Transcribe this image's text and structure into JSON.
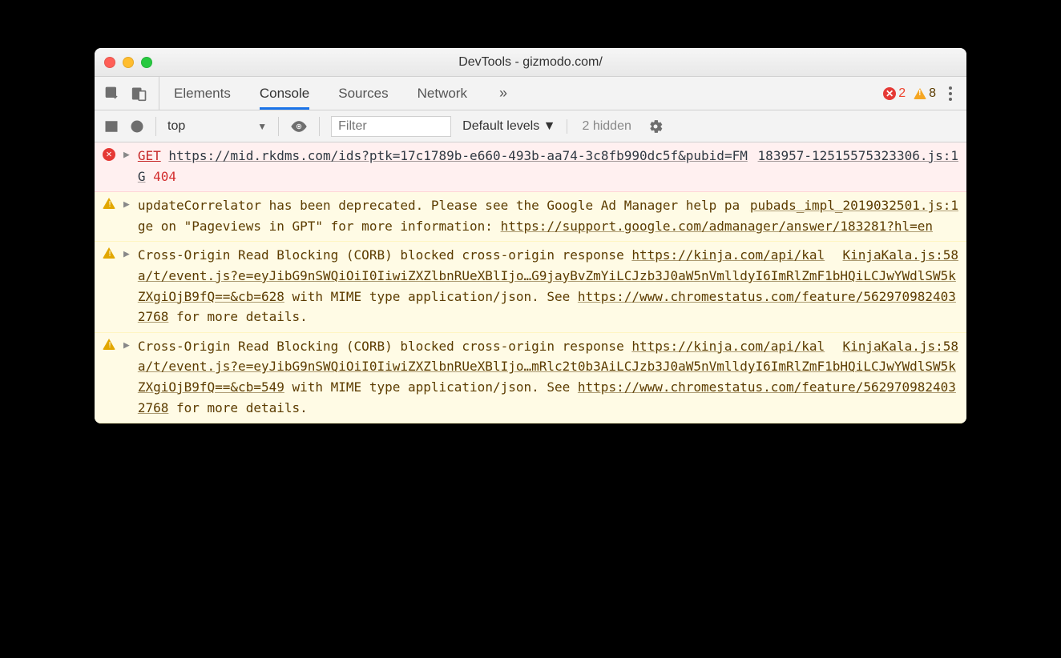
{
  "window": {
    "title": "DevTools - gizmodo.com/"
  },
  "tabs": {
    "items": [
      "Elements",
      "Console",
      "Sources",
      "Network"
    ],
    "active": 1,
    "more": "»"
  },
  "header_status": {
    "errors": "2",
    "warnings": "8"
  },
  "toolbar": {
    "context": "top",
    "filter_placeholder": "Filter",
    "levels": "Default levels ▼",
    "hidden": "2 hidden"
  },
  "messages": [
    {
      "type": "error",
      "source": "183957-12515575323306.js:1",
      "parts": {
        "method": "GET",
        "url": "https://mid.rkdms.com/ids?ptk=17c1789b-e660-493b-aa74-3c8fb990dc5f&pubid=FMG",
        "status": "404"
      }
    },
    {
      "type": "warning",
      "source": "pubads_impl_2019032501.js:1",
      "parts": {
        "pre": "updateCorrelator has been deprecated. Please see the Google Ad Manager help page on \"Pageviews in GPT\" for more information: ",
        "url": "https://support.google.com/admanager/answer/183281?hl=en"
      }
    },
    {
      "type": "warning",
      "source": "KinjaKala.js:58",
      "parts": {
        "pre": "Cross-Origin Read Blocking (CORB) blocked cross-origin response ",
        "url1": "https://kinja.com/api/kala/t/event.js?e=eyJibG9nSWQiOiI0IiwiZXZlbnRUeXBlIjo…G9jayBvZmYiLCJzb3J0aW5nVmlldyI6ImRlZmF1bHQiLCJwYWdlSW5kZXgiOjB9fQ==&cb=628",
        "mid": " with MIME type application/json. See ",
        "url2": "https://www.chromestatus.com/feature/5629709824032768",
        "post": " for more details."
      }
    },
    {
      "type": "warning",
      "source": "KinjaKala.js:58",
      "parts": {
        "pre": "Cross-Origin Read Blocking (CORB) blocked cross-origin response ",
        "url1": "https://kinja.com/api/kala/t/event.js?e=eyJibG9nSWQiOiI0IiwiZXZlbnRUeXBlIjo…mRlc2t0b3AiLCJzb3J0aW5nVmlldyI6ImRlZmF1bHQiLCJwYWdlSW5kZXgiOjB9fQ==&cb=549",
        "mid": " with MIME type application/json. See ",
        "url2": "https://www.chromestatus.com/feature/5629709824032768",
        "post": " for more details."
      }
    }
  ]
}
